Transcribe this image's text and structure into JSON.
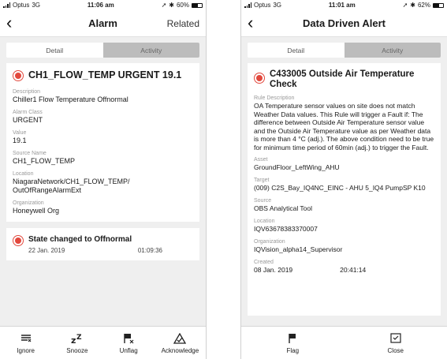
{
  "left": {
    "status": {
      "carrier": "Optus",
      "network": "3G",
      "time": "11:06 am",
      "battery": "60%",
      "battery_level": 0.6
    },
    "nav": {
      "title": "Alarm",
      "related": "Related"
    },
    "tabs": [
      "Detail",
      "Activity"
    ],
    "alarm": {
      "title": "CH1_FLOW_TEMP URGENT 19.1",
      "fields": [
        {
          "label": "Description",
          "value": "Chiller1 Flow Temperature Offnormal"
        },
        {
          "label": "Alarm Class",
          "value": "URGENT"
        },
        {
          "label": "Value",
          "value": "19.1"
        },
        {
          "label": "Source Name",
          "value": "CH1_FLOW_TEMP"
        },
        {
          "label": "Location",
          "value": "NiagaraNetwork/CH1_FLOW_TEMP/\nOutOfRangeAlarmExt"
        },
        {
          "label": "Organization",
          "value": "Honeywell Org"
        }
      ]
    },
    "event": {
      "title": "State changed to Offnormal",
      "date": "22 Jan. 2019",
      "time": "01:09:36"
    },
    "toolbar": [
      {
        "label": "Ignore",
        "icon": "ignore-icon"
      },
      {
        "label": "Snooze",
        "icon": "snooze-icon"
      },
      {
        "label": "Unflag",
        "icon": "unflag-icon"
      },
      {
        "label": "Acknowledge",
        "icon": "acknowledge-icon"
      }
    ]
  },
  "right": {
    "status": {
      "carrier": "Optus",
      "network": "3G",
      "time": "11:01 am",
      "battery": "62%",
      "battery_level": 0.62
    },
    "nav": {
      "title": "Data Driven Alert"
    },
    "tabs": [
      "Detail",
      "Activity"
    ],
    "alert": {
      "title": "C433005 Outside Air Temperature Check",
      "fields": [
        {
          "label": "Rule Description",
          "value": "OA Temperature sensor values on site does not match Weather Data values.  This Rule will trigger a Fault if:  The difference between Outside Air Temperature sensor value and the Outside Air Temperature value as per Weather data is more than 4 °C (adj.).  The above condition need to be true for minimum time period of 60min (adj.) to trigger the Fault."
        },
        {
          "label": "Asset",
          "value": "GroundFloor_LeftWing_AHU"
        },
        {
          "label": "Target",
          "value": "(009) C2S_Bay_IQ4NC_EINC - AHU 5_IQ4 PumpSP K10"
        },
        {
          "label": "Source",
          "value": "OBS Analytical Tool"
        },
        {
          "label": "Location",
          "value": "IQV63678383370007"
        },
        {
          "label": "Organization",
          "value": "IQVision_alpha14_Supervisor"
        }
      ],
      "created": {
        "label": "Created",
        "date": "08 Jan. 2019",
        "time": "20:41:14"
      }
    },
    "toolbar": [
      {
        "label": "Flag",
        "icon": "flag-icon"
      },
      {
        "label": "Close",
        "icon": "close-box-icon"
      }
    ]
  }
}
